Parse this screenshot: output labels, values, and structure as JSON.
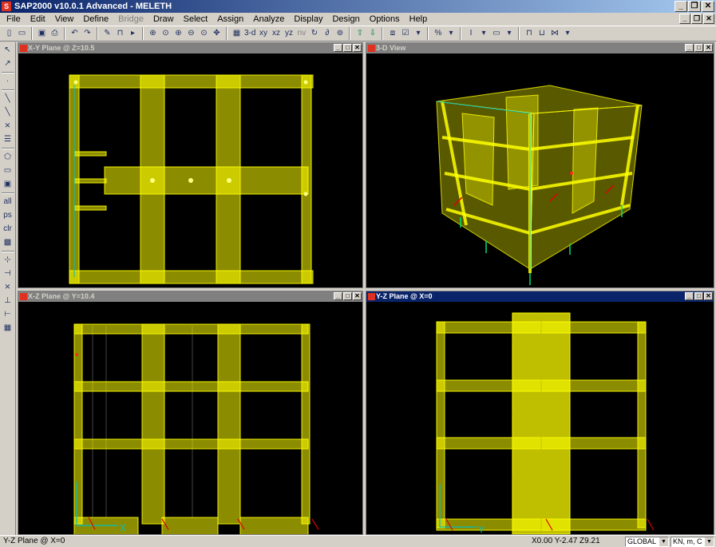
{
  "app": {
    "title": "SAP2000 v10.0.1 Advanced  - MELETH"
  },
  "window_buttons": {
    "minimize": "_",
    "restore": "❐",
    "close": "✕"
  },
  "menu": [
    {
      "label": "File",
      "enabled": true
    },
    {
      "label": "Edit",
      "enabled": true
    },
    {
      "label": "View",
      "enabled": true
    },
    {
      "label": "Define",
      "enabled": true
    },
    {
      "label": "Bridge",
      "enabled": false
    },
    {
      "label": "Draw",
      "enabled": true
    },
    {
      "label": "Select",
      "enabled": true
    },
    {
      "label": "Assign",
      "enabled": true
    },
    {
      "label": "Analyze",
      "enabled": true
    },
    {
      "label": "Display",
      "enabled": true
    },
    {
      "label": "Design",
      "enabled": true
    },
    {
      "label": "Options",
      "enabled": true
    },
    {
      "label": "Help",
      "enabled": true
    }
  ],
  "toolbar": {
    "view_3d": "3-d",
    "view_xy": "xy",
    "view_xz": "xz",
    "view_yz": "yz",
    "view_nv": "nv"
  },
  "windows": [
    {
      "id": "xy",
      "title": "X-Y Plane @ Z=10.5"
    },
    {
      "id": "3d",
      "title": "3-D View"
    },
    {
      "id": "xz",
      "title": "X-Z Plane @ Y=10.4"
    },
    {
      "id": "yz",
      "title": "Y-Z Plane @ X=0"
    }
  ],
  "axis_labels": {
    "x": "X",
    "y": "Y"
  },
  "status": {
    "left": "Y-Z Plane @ X=0",
    "coords": "X0.00  Y-2.47  Z9.21",
    "coord_system": "GLOBAL",
    "units": "KN, m, C"
  },
  "colors": {
    "member": "#ffff00",
    "background": "#000000",
    "restraint": "#00c060",
    "axis": "#e00000",
    "accent": "#0a246a"
  }
}
